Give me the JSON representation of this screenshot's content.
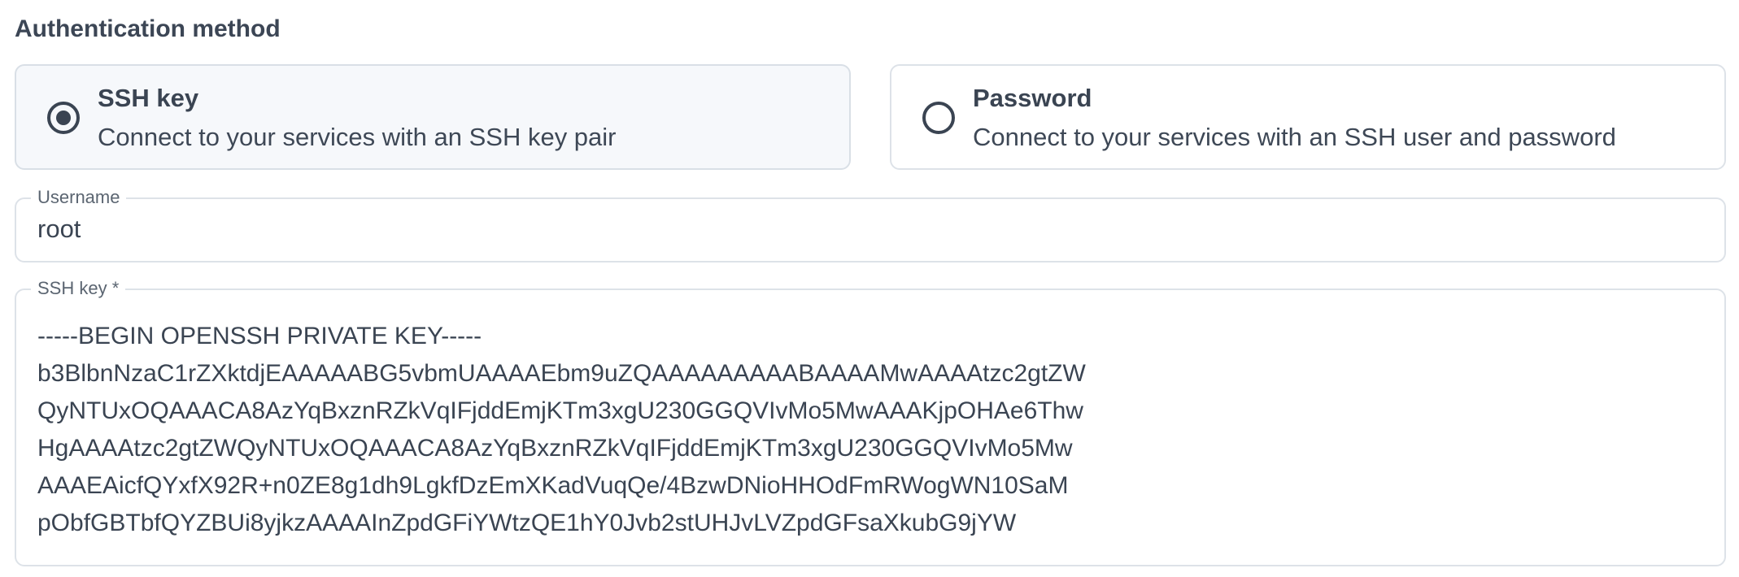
{
  "section": {
    "title": "Authentication method"
  },
  "auth_options": [
    {
      "title": "SSH key",
      "description": "Connect to your services with an SSH key pair",
      "selected": true
    },
    {
      "title": "Password",
      "description": "Connect to your services with an SSH user and password",
      "selected": false
    }
  ],
  "username": {
    "label": "Username",
    "value": "root"
  },
  "ssh_key": {
    "label": "SSH key *",
    "value": "-----BEGIN OPENSSH PRIVATE KEY-----\nb3BlbnNzaC1rZXktdjEAAAAABG5vbmUAAAAEbm9uZQAAAAAAAAABAAAAMwAAAAtzc2gtZW\nQyNTUxOQAAACA8AzYqBxznRZkVqIFjddEmjKTm3xgU230GGQVIvMo5MwAAAKjpOHAe6Thw\nHgAAAAtzc2gtZWQyNTUxOQAAACA8AzYqBxznRZkVqIFjddEmjKTm3xgU230GGQVIvMo5Mw\nAAAEAicfQYxfX92R+n0ZE8g1dh9LgkfDzEmXKadVuqQe/4BzwDNioHHOdFmRWogWN10SaM\npObfGBTbfQYZBUi8yjkzAAAAInZpdGFiYWtzQE1hY0Jvb2stUHJvLVZpdGFsaXkubG9jYW"
  },
  "colors": {
    "text": "#3a4452",
    "border": "#dde2e8",
    "selected_bg": "#f6f8fb"
  }
}
